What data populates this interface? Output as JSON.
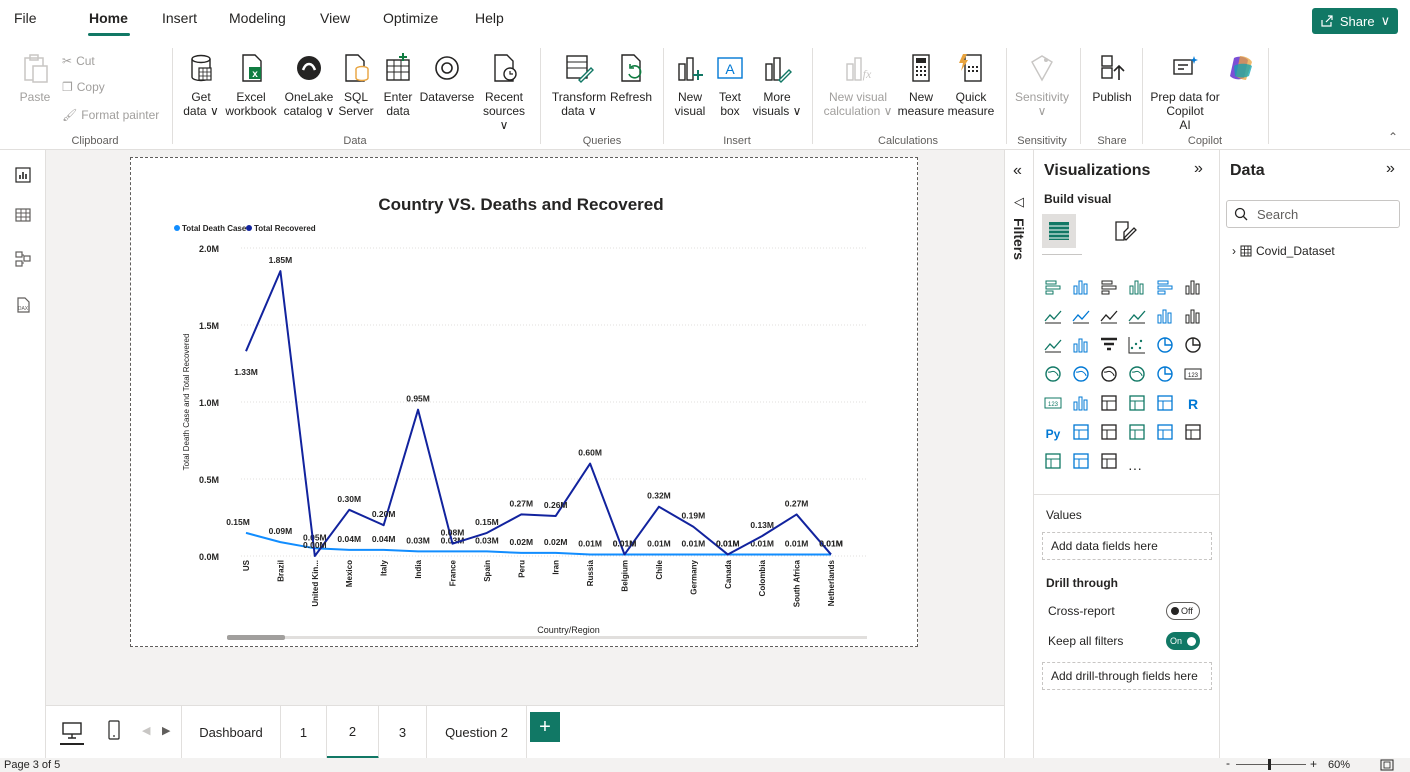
{
  "menu": {
    "items": [
      "File",
      "Home",
      "Insert",
      "Modeling",
      "View",
      "Optimize",
      "Help"
    ],
    "share_label": "Share"
  },
  "ribbon": {
    "clipboard": {
      "paste": "Paste",
      "cut": "Cut",
      "copy": "Copy",
      "format_painter": "Format painter",
      "group": "Clipboard"
    },
    "data": {
      "get_data": [
        "Get",
        "data ∨"
      ],
      "excel": [
        "Excel",
        "workbook"
      ],
      "onelake": [
        "OneLake",
        "catalog ∨"
      ],
      "sql": [
        "SQL",
        "Server"
      ],
      "enter": [
        "Enter",
        "data"
      ],
      "dataverse": [
        "Dataverse",
        ""
      ],
      "recent": [
        "Recent",
        "sources ∨"
      ],
      "group": "Data"
    },
    "queries": {
      "transform": [
        "Transform",
        "data ∨"
      ],
      "refresh": [
        "Refresh",
        ""
      ],
      "group": "Queries"
    },
    "insert": {
      "new_visual": [
        "New",
        "visual"
      ],
      "text_box": [
        "Text",
        "box"
      ],
      "more_visuals": [
        "More",
        "visuals ∨"
      ],
      "group": "Insert"
    },
    "calculations": {
      "new_visual_calc": [
        "New visual",
        "calculation ∨"
      ],
      "new_measure": [
        "New",
        "measure"
      ],
      "quick_measure": [
        "Quick",
        "measure"
      ],
      "group": "Calculations"
    },
    "sensitivity": {
      "label": [
        "Sensitivity",
        "∨"
      ],
      "group": "Sensitivity"
    },
    "share": {
      "publish": [
        "Publish",
        ""
      ],
      "group": "Share"
    },
    "copilot": {
      "prep": [
        "Prep data for Copilot",
        "AI"
      ],
      "group": "Copilot"
    }
  },
  "chart_data": {
    "type": "line",
    "title": "Country VS. Deaths and Recovered",
    "xlabel": "Country/Region",
    "ylabel": "Total Death Case and Total Recovered",
    "categories": [
      "US",
      "Brazil",
      "United Kin...",
      "Mexico",
      "Italy",
      "India",
      "France",
      "Spain",
      "Peru",
      "Iran",
      "Russia",
      "Belgium",
      "Chile",
      "Germany",
      "Canada",
      "Colombia",
      "South Africa",
      "Netherlands"
    ],
    "series": [
      {
        "name": "Total Death Case",
        "color": "#118DFF",
        "values": [
          0.15,
          0.09,
          0.05,
          0.04,
          0.04,
          0.03,
          0.03,
          0.03,
          0.02,
          0.02,
          0.01,
          0.01,
          0.01,
          0.01,
          0.01,
          0.01,
          0.01,
          0.01
        ],
        "labels": [
          "0.15M",
          "0.09M",
          "0.05M",
          "0.04M",
          "0.04M",
          "0.03M",
          "0.03M",
          "0.03M",
          "0.02M",
          "0.02M",
          "0.01M",
          "0.01M",
          "0.01M",
          "0.01M",
          "0.01M",
          "0.01M",
          "0.01M",
          "0.01M"
        ]
      },
      {
        "name": "Total Recovered",
        "color": "#12239E",
        "values": [
          1.33,
          1.85,
          0.0,
          0.3,
          0.2,
          0.95,
          0.08,
          0.15,
          0.27,
          0.26,
          0.6,
          0.01,
          0.32,
          0.19,
          0.01,
          0.13,
          0.27,
          0.01
        ],
        "labels": [
          "1.33M",
          "1.85M",
          "0.00M",
          "0.30M",
          "0.20M",
          "0.95M",
          "0.08M",
          "0.15M",
          "0.27M",
          "0.26M",
          "0.60M",
          "0.01M",
          "0.32M",
          "0.19M",
          "0.01M",
          "0.13M",
          "0.27M",
          "0.01M"
        ]
      }
    ],
    "yticks": [
      "0.0M",
      "0.5M",
      "1.0M",
      "1.5M",
      "2.0M"
    ],
    "ytick_values": [
      0,
      0.5,
      1.0,
      1.5,
      2.0
    ],
    "ylim": [
      0,
      2.0
    ],
    "legend": "top-left",
    "grid": true
  },
  "pages": {
    "tabs": [
      "Dashboard",
      "1",
      "2",
      "3",
      "Question 2"
    ],
    "active_index": 2,
    "add_label": "+"
  },
  "status": {
    "page": "Page 3 of 5",
    "zoom": "60%"
  },
  "filters": {
    "label": "Filters"
  },
  "visualizations": {
    "title": "Visualizations",
    "build_visual": "Build visual",
    "values_label": "Values",
    "values_placeholder": "Add data fields here",
    "drill_through": "Drill through",
    "cross_report": "Cross-report",
    "cross_report_state": "Off",
    "keep_all_filters": "Keep all filters",
    "keep_all_filters_state": "On",
    "drill_placeholder": "Add drill-through fields here",
    "more": "···"
  },
  "data_pane": {
    "title": "Data",
    "search_placeholder": "Search",
    "table": "Covid_Dataset"
  }
}
